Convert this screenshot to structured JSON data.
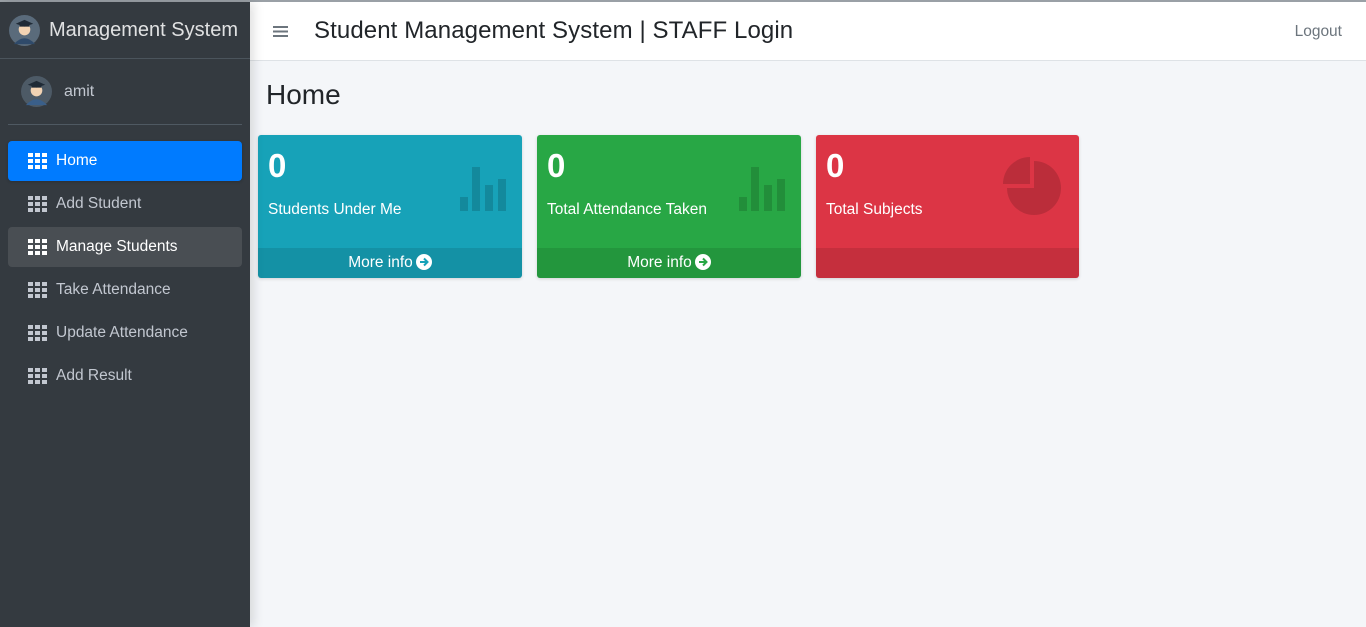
{
  "sidebar": {
    "brand": "Management System",
    "user": "amit",
    "items": [
      {
        "label": "Home"
      },
      {
        "label": "Add Student"
      },
      {
        "label": "Manage Students"
      },
      {
        "label": "Take Attendance"
      },
      {
        "label": "Update Attendance"
      },
      {
        "label": "Add Result"
      }
    ]
  },
  "header": {
    "title": "Student Management System | STAFF Login",
    "logout": "Logout"
  },
  "main": {
    "page_title": "Home",
    "boxes": [
      {
        "count": "0",
        "label": "Students Under Me",
        "footer": "More info",
        "color": "#17a2b8",
        "icon": "bar-chart-icon"
      },
      {
        "count": "0",
        "label": "Total Attendance Taken",
        "footer": "More info",
        "color": "#28a745",
        "icon": "bar-chart-icon"
      },
      {
        "count": "0",
        "label": "Total Subjects",
        "footer": "",
        "color": "#dc3545",
        "icon": "pie-chart-icon"
      }
    ]
  },
  "colors": {
    "sidebar_bg": "#343a40",
    "active": "#007bff",
    "content_bg": "#f4f6f9"
  }
}
